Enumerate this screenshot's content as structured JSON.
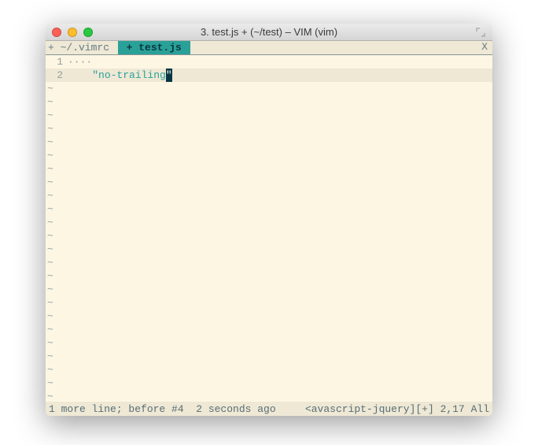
{
  "window": {
    "title": "3. test.js + (~/test) – VIM (vim)"
  },
  "tabs": [
    {
      "label": "+ ~/.vimrc ",
      "active": false
    },
    {
      "label": " + test.js ",
      "active": true
    }
  ],
  "tab_close": "X",
  "lines": [
    {
      "num": "1",
      "fold": "····",
      "content": "",
      "current": false
    },
    {
      "num": "2",
      "indent": "    ",
      "string_open": "\"",
      "string_body": "no-trailing",
      "cursor_char": "\"",
      "current": true
    }
  ],
  "empty_tilde": "~",
  "tilde_count": 24,
  "status": {
    "left": "1 more line; before #4  2 seconds ago",
    "right": "<avascript-jquery][+] 2,17 All"
  }
}
